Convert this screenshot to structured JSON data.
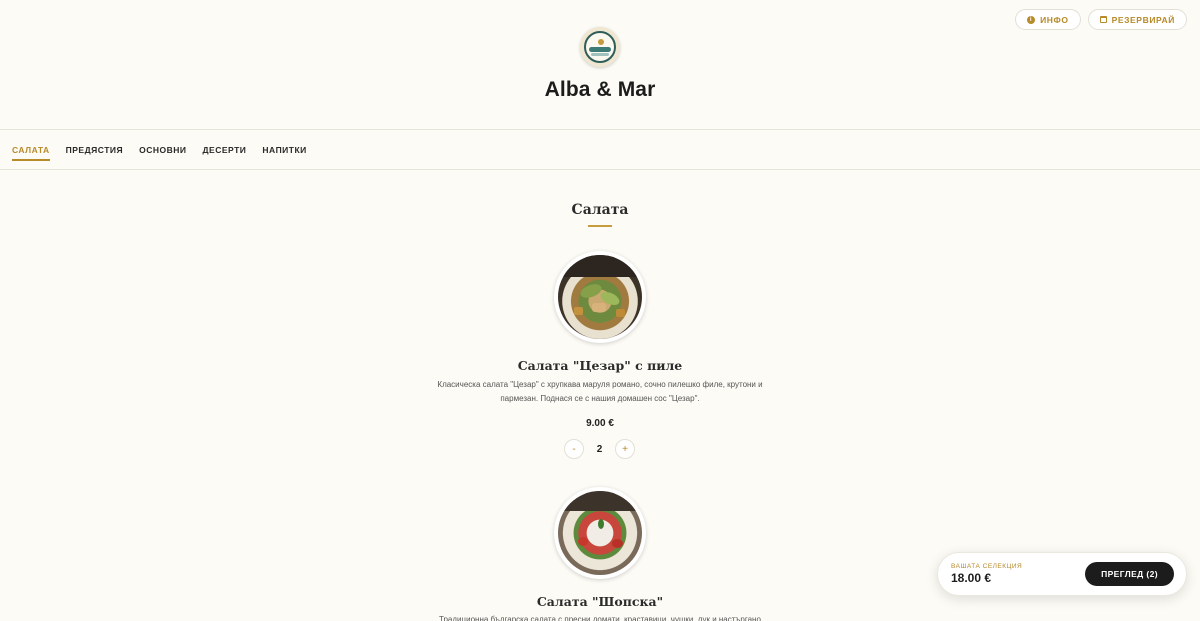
{
  "header": {
    "brand": "Alba & Mar",
    "info_label": "ИНФО",
    "reserve_label": "РЕЗЕРВИРАЙ"
  },
  "nav": {
    "items": [
      {
        "label": "САЛАТА",
        "active": true
      },
      {
        "label": "ПРЕДЯСТИЯ",
        "active": false
      },
      {
        "label": "ОСНОВНИ",
        "active": false
      },
      {
        "label": "ДЕСЕРТИ",
        "active": false
      },
      {
        "label": "НАПИТКИ",
        "active": false
      }
    ]
  },
  "section": {
    "title": "Салата"
  },
  "dishes": [
    {
      "name": "Салата \"Цезар\" с пиле",
      "description": "Класическа салата \"Цезар\" с хрупкава маруля романо, сочно пилешко филе, крутони и пармезан. Поднася се с нашия домашен сос \"Цезар\".",
      "price": "9.00 €",
      "minus": "-",
      "quantity": "2",
      "plus": "+"
    },
    {
      "name": "Салата \"Шопска\"",
      "description": "Традиционна българска салата с пресни домати, краставици, чушки, лук и настъргано сирене."
    }
  ],
  "cart": {
    "label": "ВАШАТА СЕЛЕКЦИЯ",
    "total": "18.00 €",
    "button_label": "ПРЕГЛЕД (2)"
  },
  "colors": {
    "accent": "#b78a2a",
    "background": "#fcfbf5",
    "dark": "#1c1c1c"
  }
}
